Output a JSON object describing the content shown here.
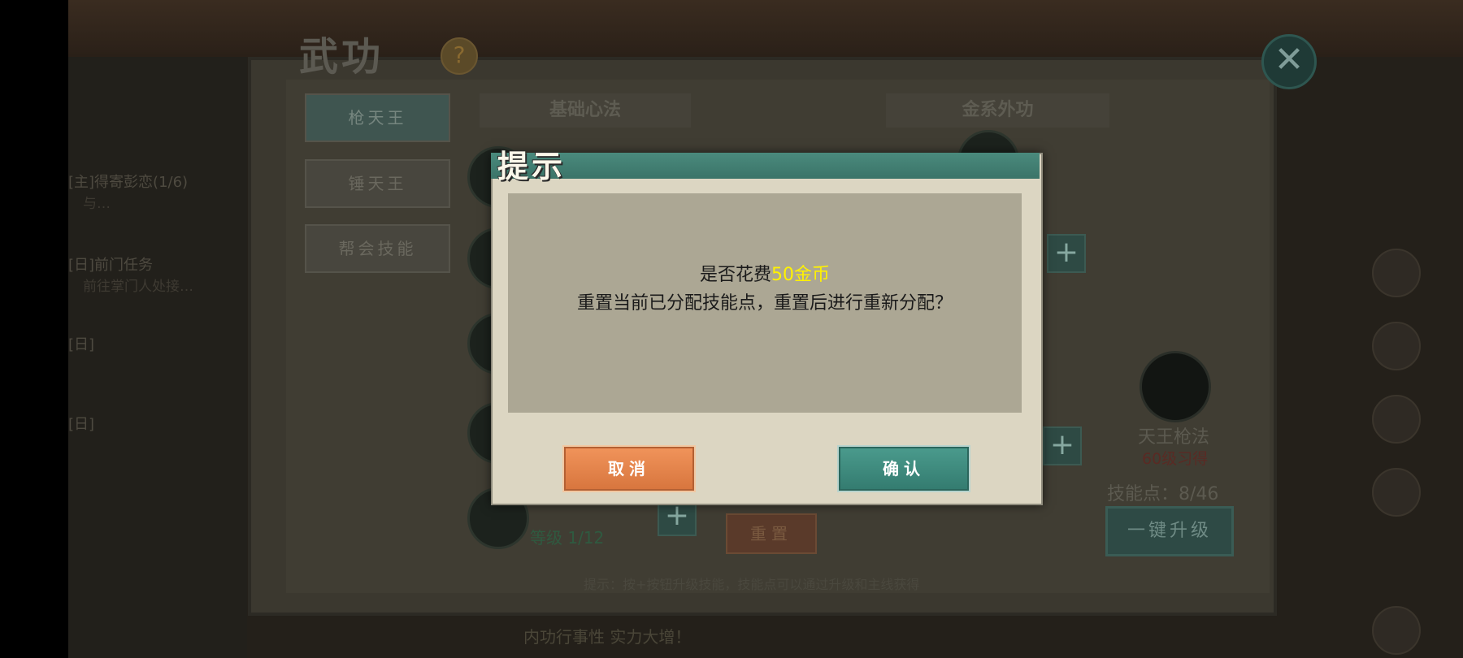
{
  "window": {
    "title": "武功",
    "help_icon": "?",
    "close_icon": "✕",
    "tabs": [
      "枪天王",
      "锤天王",
      "帮会技能"
    ],
    "sections": [
      "基础心法",
      "金系外功"
    ],
    "skill_level": "等级 1/12",
    "featured_skill": {
      "name": "天王枪法",
      "requirement": "60级习得"
    },
    "skill_points": "技能点：8/46",
    "reset_label": "重置",
    "one_click_label": "一键升级",
    "footer_tip": "提示：按+按钮升级技能，技能点可以通过升级和主线获得"
  },
  "quests": [
    {
      "title": "[主]得寄彭恋(1/6)",
      "detail": "与…"
    },
    {
      "title": "[日]前门任务",
      "detail": "前往掌门人处接…"
    },
    {
      "title": "[日]",
      "detail": ""
    },
    {
      "title": "[日]",
      "detail": ""
    }
  ],
  "dialog": {
    "title": "提示",
    "message_prefix": "是否花费",
    "message_cost": "50金币",
    "message_line2": "重置当前已分配技能点，重置后进行重新分配？",
    "cancel_label": "取消",
    "confirm_label": "确认",
    "colors": {
      "highlight": "#fff200",
      "cancel": "#e8844b",
      "confirm": "#3f8a7d"
    }
  },
  "chat": {
    "line1": "内功行事性  实力大增！"
  }
}
